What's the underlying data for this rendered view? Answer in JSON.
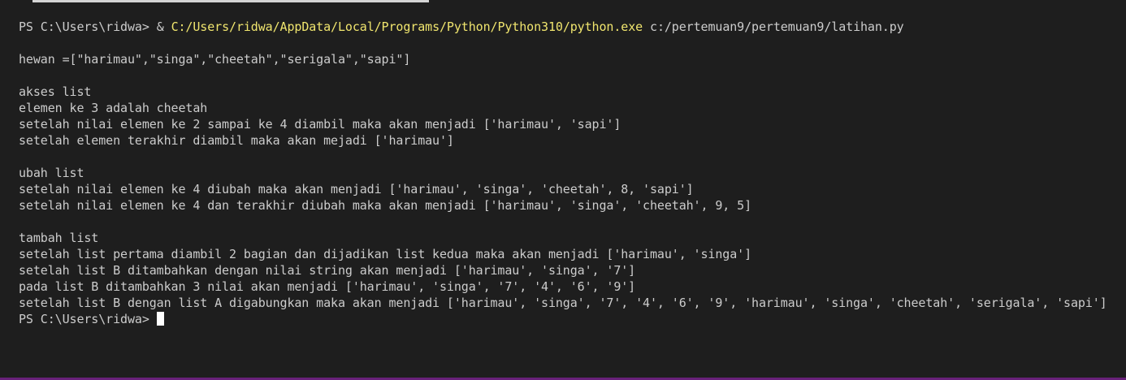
{
  "terminal": {
    "command": {
      "prompt": "PS C:\\Users\\ridwa> ",
      "operator": "& ",
      "exe": "C:/Users/ridwa/AppData/Local/Programs/Python/Python310/python.exe",
      "arg": " c:/pertemuan9/pertemuan9/latihan.py"
    },
    "output": [
      "",
      "hewan =[\"harimau\",\"singa\",\"cheetah\",\"serigala\",\"sapi\"]",
      "",
      "akses list",
      "elemen ke 3 adalah cheetah",
      "setelah nilai elemen ke 2 sampai ke 4 diambil maka akan menjadi ['harimau', 'sapi']",
      "setelah elemen terakhir diambil maka akan mejadi ['harimau']",
      "",
      "ubah list",
      "setelah nilai elemen ke 4 diubah maka akan menjadi ['harimau', 'singa', 'cheetah', 8, 'sapi']",
      "setelah nilai elemen ke 4 dan terakhir diubah maka akan menjadi ['harimau', 'singa', 'cheetah', 9, 5]",
      "",
      "tambah list",
      "setelah list pertama diambil 2 bagian dan dijadikan list kedua maka akan menjadi ['harimau', 'singa']",
      "setelah list B ditambahkan dengan nilai string akan menjadi ['harimau', 'singa', '7']",
      "pada list B ditambahkan 3 nilai akan menjadi ['harimau', 'singa', '7', '4', '6', '9']",
      "setelah list B dengan list A digabungkan maka akan menjadi ['harimau', 'singa', '7', '4', '6', '9', 'harimau', 'singa', 'cheetah', 'serigala', 'sapi']"
    ],
    "final_prompt": "PS C:\\Users\\ridwa> "
  },
  "colors": {
    "background": "#1e1e1e",
    "text": "#cccccc",
    "executable_path": "#f0e56e",
    "cursor": "#ffffff",
    "status_border": "#68217a"
  },
  "icons": {
    "cursor": "block-cursor-icon"
  }
}
